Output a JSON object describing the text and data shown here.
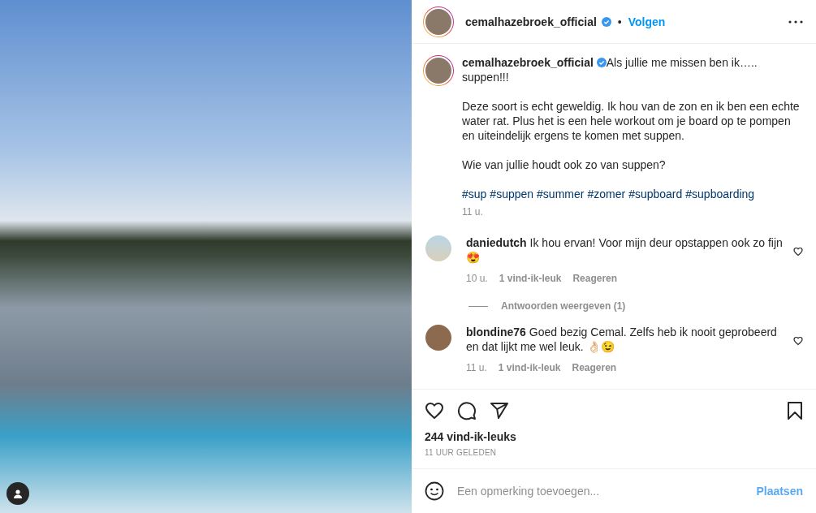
{
  "post": {
    "username": "cemalhazebroek_official",
    "verified": true,
    "separator": "•",
    "follow": "Volgen",
    "liked": false,
    "saved": false,
    "likes": "244 vind-ik-leuks",
    "posted": "11 UUR GELEDEN"
  },
  "caption": {
    "username": "cemalhazebroek_official",
    "verified": true,
    "paragraphs": [
      "Als jullie me missen ben ik….. suppen!!!",
      "Deze soort is echt geweldig. Ik hou van de zon en ik ben een echte water rat. Plus het is een hele workout om je board op te pompen en uiteindelijk ergens te komen met suppen.",
      "Wie van jullie houdt ook zo van suppen?"
    ],
    "hashtags": [
      "#sup",
      "#suppen",
      "#summer",
      "#zomer",
      "#supboard",
      "#supboarding"
    ],
    "time": "11 u."
  },
  "comments": [
    {
      "username": "daniedutch",
      "text": "Ik hou ervan! Voor mijn deur opstappen ook zo fijn 😍",
      "time": "10 u.",
      "likes": "1 vind-ik-leuk",
      "reply": "Reageren",
      "liked": false,
      "replies": "Antwoorden weergeven (1)"
    },
    {
      "username": "blondine76",
      "text": "Goed bezig Cemal. Zelfs heb ik nooit geprobeerd en dat lijkt me wel leuk. 👌🏻😉",
      "time": "11 u.",
      "likes": "1 vind-ik-leuk",
      "reply": "Reageren",
      "liked": false
    }
  ],
  "composer": {
    "placeholder": "Een opmerking toevoegen...",
    "submit": "Plaatsen",
    "disabled": true
  }
}
